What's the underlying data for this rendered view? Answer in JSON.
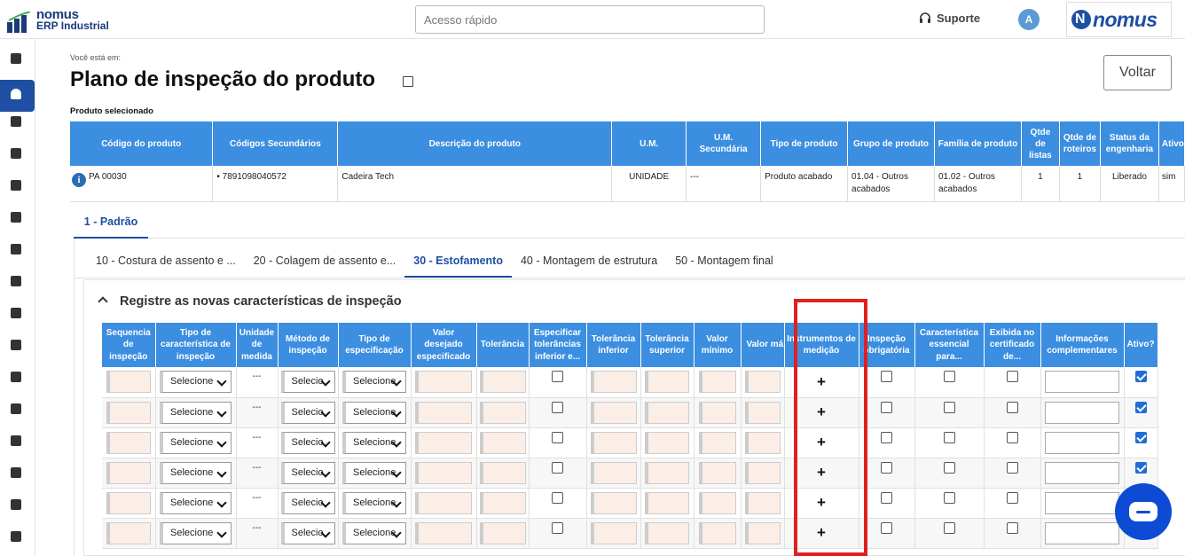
{
  "app": {
    "logo_line1": "nomus",
    "logo_line2": "ERP Industrial",
    "brand": "nomus"
  },
  "header": {
    "quick_placeholder": "Acesso rápido",
    "support": "Suporte",
    "avatar": "A"
  },
  "sidebar": {
    "icons": [
      "book-icon",
      "user-icon",
      "gear-icon",
      "flow-icon",
      "flag-icon",
      "briefcase-icon",
      "document-icon",
      "factory-icon",
      "conveyor-icon",
      "archive-icon",
      "cart-icon",
      "crane-icon",
      "gears-icon",
      "dollar-icon",
      "calculator-icon",
      "file-icon"
    ],
    "active": 1
  },
  "page": {
    "breadcrumb": "Você está em:",
    "title": "Plano de inspeção do produto",
    "back": "Voltar",
    "product_label": "Produto selecionado"
  },
  "product_table": {
    "headers": [
      "Código do produto",
      "Códigos Secundários",
      "Descrição do produto",
      "U.M.",
      "U.M. Secundária",
      "Tipo de produto",
      "Grupo de produto",
      "Família de produto",
      "Qtde de listas",
      "Qtde de roteiros",
      "Status da engenharia",
      "Ativo"
    ],
    "row": [
      "PA 00030",
      "•  7891098040572",
      "Cadeira Tech",
      "UNIDADE",
      "---",
      "Produto acabado",
      "01.04 - Outros acabados",
      "01.02 - Outros acabados",
      "1",
      "1",
      "Liberado",
      "sim"
    ]
  },
  "tabs": {
    "main": "1 - Padrão",
    "operations": [
      "10 - Costura de assento e ...",
      "20 - Colagem de assento e...",
      "30 - Estofamento",
      "40 - Montagem de estrutura",
      "50 - Montagem final"
    ],
    "active_operation": 2
  },
  "section": {
    "title": "Registre as novas características de inspeção"
  },
  "inspection_table": {
    "headers": [
      "Sequencia de inspeção",
      "Tipo de característica de inspeção",
      "Unidade de medida",
      "Método de inspeção",
      "Tipo de especificação",
      "Valor desejado especificado",
      "Tolerância",
      "Especificar tolerâncias inferior e...",
      "Tolerância inferior",
      "Tolerância superior",
      "Valor mínimo",
      "Valor máximo",
      "Instrumentos de medição",
      "Inspeção obrigatória",
      "Característica essencial para...",
      "Exibida no certificado de...",
      "Informações complementares",
      "Ativo?"
    ],
    "select_label": "Selecione",
    "select_label_short": "Selecio",
    "unit_value": "---",
    "plus": "+",
    "rows": [
      {
        "ativo": true
      },
      {
        "ativo": true
      },
      {
        "ativo": true
      },
      {
        "ativo": true
      },
      {
        "ativo": false
      },
      {
        "ativo": false
      }
    ]
  }
}
